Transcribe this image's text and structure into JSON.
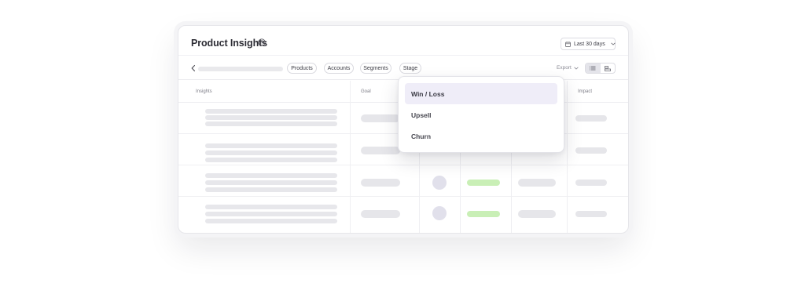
{
  "header": {
    "title": "Product Insights",
    "date_range": "Last 30 days"
  },
  "toolbar": {
    "filters": [
      "Products",
      "Accounts",
      "Segments",
      "Stage"
    ],
    "export_label": "Export"
  },
  "table": {
    "columns": [
      "Insights",
      "Goal",
      "Impact"
    ]
  },
  "dropdown": {
    "options": [
      "Win / Loss",
      "Upsell",
      "Churn"
    ],
    "selected": "Win / Loss"
  },
  "colors": {
    "accent_highlight": "#efedf8",
    "positive": "#c9efb6",
    "skeleton": "#e7e7eb"
  }
}
